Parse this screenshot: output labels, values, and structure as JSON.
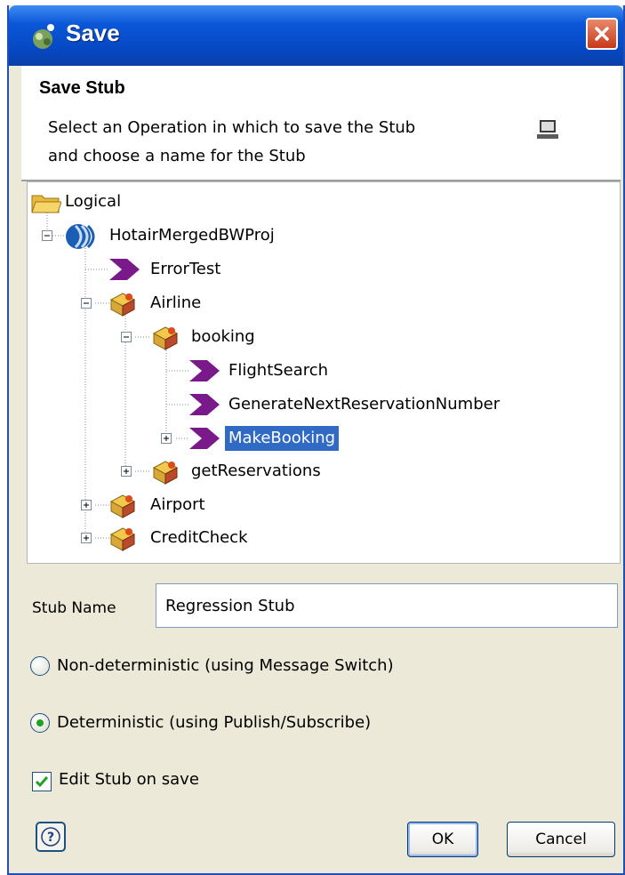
{
  "window": {
    "title": "Save"
  },
  "header": {
    "title": "Save Stub",
    "line1": "Select an Operation in which to save the Stub",
    "line2": "and choose a name for the Stub"
  },
  "tree": {
    "root": "Logical",
    "project": "HotairMergedBWProj",
    "items": {
      "error_test": "ErrorTest",
      "airline": "Airline",
      "booking": "booking",
      "flight_search": "FlightSearch",
      "generate_next": "GenerateNextReservationNumber",
      "make_booking": "MakeBooking",
      "get_reservations": "getReservations",
      "airport": "Airport",
      "credit_check": "CreditCheck"
    },
    "selected": "MakeBooking"
  },
  "form": {
    "stub_name_label": "Stub Name",
    "stub_name_value": "Regression Stub",
    "option_nondeterministic": "Non-deterministic (using Message Switch)",
    "option_deterministic": "Deterministic (using Publish/Subscribe)",
    "selected_option": "deterministic",
    "edit_on_save_label": "Edit Stub on save",
    "edit_on_save_checked": true
  },
  "buttons": {
    "ok": "OK",
    "cancel": "Cancel"
  },
  "colors": {
    "titlebar": "#0a57d8",
    "selection": "#316ac5",
    "operation": "#7a1a8a",
    "panel": "#ece9d8"
  }
}
